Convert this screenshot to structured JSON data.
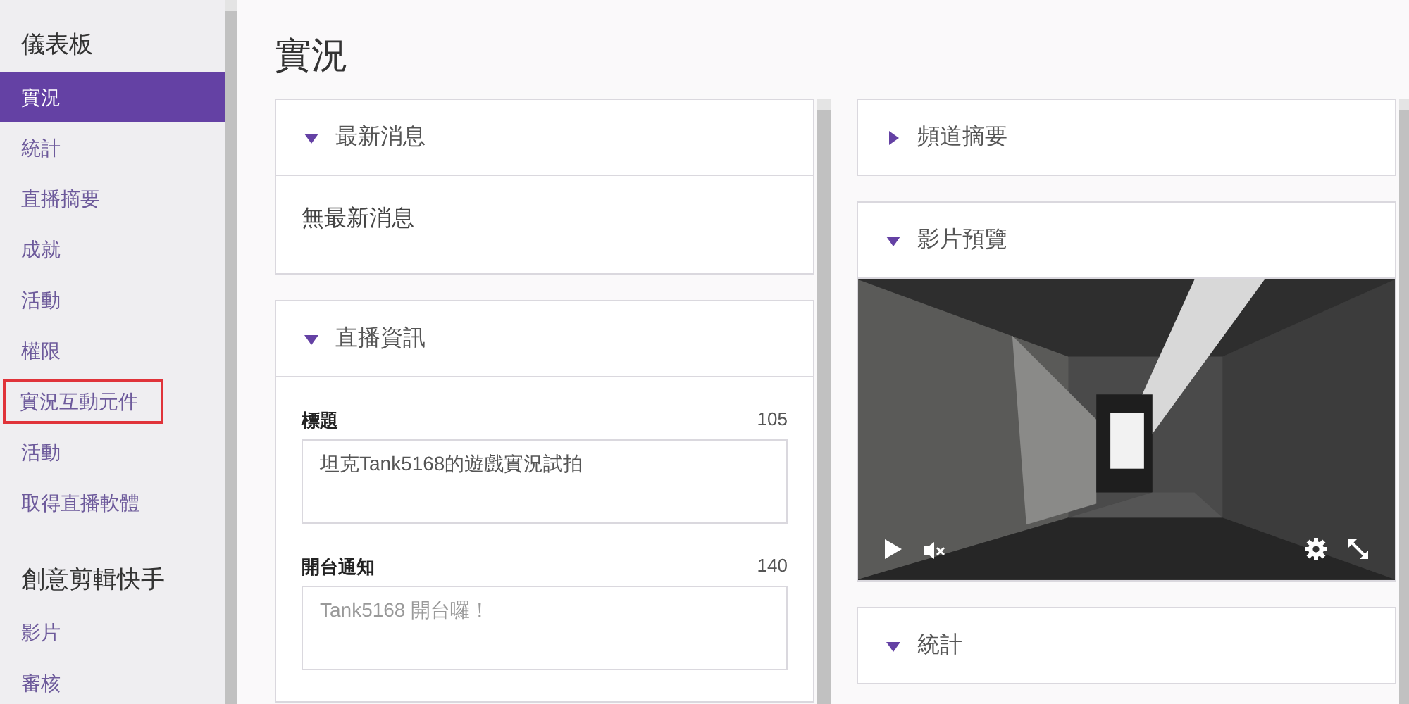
{
  "sidebar": {
    "groups": [
      {
        "title": "儀表板",
        "items": [
          {
            "label": "實況",
            "selected": true,
            "outlined": false
          },
          {
            "label": "統計",
            "selected": false,
            "outlined": false
          },
          {
            "label": "直播摘要",
            "selected": false,
            "outlined": false
          },
          {
            "label": "成就",
            "selected": false,
            "outlined": false
          },
          {
            "label": "活動",
            "selected": false,
            "outlined": false
          },
          {
            "label": "權限",
            "selected": false,
            "outlined": false
          },
          {
            "label": "實況互動元件",
            "selected": false,
            "outlined": true
          },
          {
            "label": "活動",
            "selected": false,
            "outlined": false
          },
          {
            "label": "取得直播軟體",
            "selected": false,
            "outlined": false
          }
        ]
      },
      {
        "title": "創意剪輯快手",
        "items": [
          {
            "label": "影片",
            "selected": false,
            "outlined": false
          },
          {
            "label": "審核",
            "selected": false,
            "outlined": false
          }
        ]
      }
    ]
  },
  "page_title": "實況",
  "columns": [
    {
      "panels": [
        {
          "kind": "message",
          "title": "最新消息",
          "expanded": true,
          "text": "無最新消息"
        },
        {
          "kind": "form",
          "title": "直播資訊",
          "expanded": true,
          "fields": [
            {
              "label": "標題",
              "count": "105",
              "value": "坦克Tank5168的遊戲實況試拍"
            },
            {
              "label": "開台通知",
              "count": "140",
              "placeholder": "Tank5168 開台囉！"
            }
          ]
        }
      ]
    },
    {
      "panels": [
        {
          "title": "頻道摘要",
          "expanded": false
        },
        {
          "kind": "video",
          "title": "影片預覽",
          "expanded": true
        },
        {
          "kind": "plain",
          "title": "統計",
          "expanded": true
        }
      ]
    }
  ]
}
